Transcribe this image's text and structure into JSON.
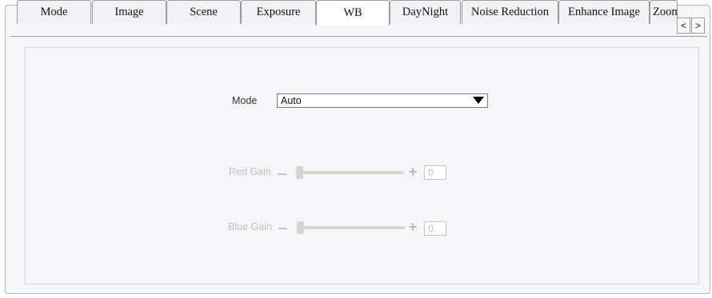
{
  "tabs": [
    {
      "label": "Mode"
    },
    {
      "label": "Image"
    },
    {
      "label": "Scene"
    },
    {
      "label": "Exposure"
    },
    {
      "label": "WB"
    },
    {
      "label": "DayNight"
    },
    {
      "label": "Noise Reduction"
    },
    {
      "label": "Enhance Image"
    },
    {
      "label": "Zoom"
    }
  ],
  "active_tab": "WB",
  "scroll": {
    "prev": "<",
    "next": ">"
  },
  "mode": {
    "label": "Mode",
    "value": "Auto"
  },
  "red_gain": {
    "label": "Red Gain",
    "minus": "—",
    "plus": "+",
    "value": "0",
    "level": 0
  },
  "blue_gain": {
    "label": "Blue Gain",
    "minus": "—",
    "plus": "+",
    "value": "0",
    "level": 0
  }
}
